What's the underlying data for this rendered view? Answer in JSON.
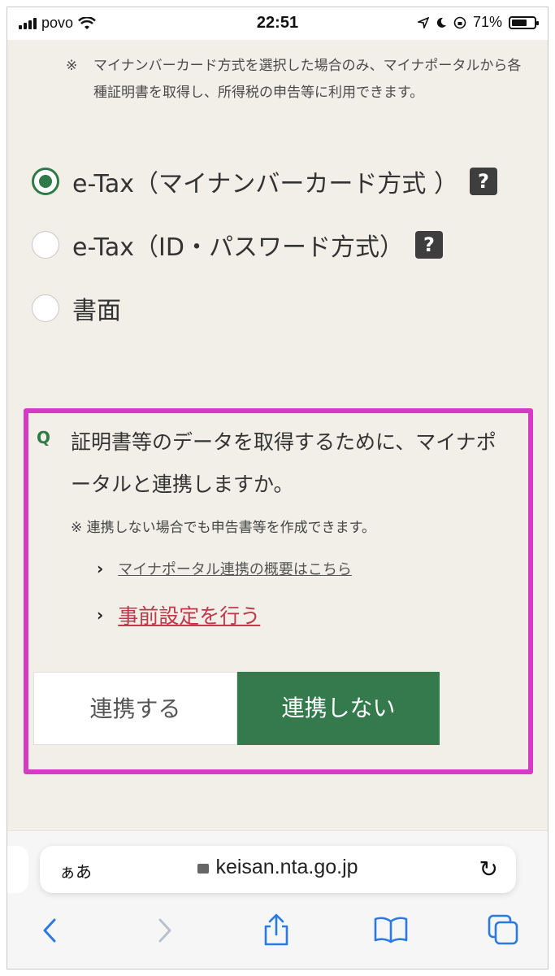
{
  "status_bar": {
    "carrier": "povo",
    "time": "22:51",
    "battery": "71%",
    "battery_level": 0.71
  },
  "note_top": {
    "mark": "※",
    "text": "マイナンバーカード方式を選択した場合のみ、マイナポータルから各種証明書を取得し、所得税の申告等に利用できます。"
  },
  "options": [
    {
      "label": "e-Tax（マイナンバーカード方式 ）",
      "checked": true,
      "help": "?"
    },
    {
      "label": "e-Tax（ID・パスワード方式）",
      "checked": false,
      "help": "?"
    },
    {
      "label": "書面",
      "checked": false
    }
  ],
  "question": {
    "mark": "Q",
    "text": "証明書等のデータを取得するために、マイナポータルと連携しますか。",
    "note": "※ 連携しない場合でも申告書等を作成できます。",
    "links": [
      {
        "label": "マイナポータル連携の概要はこちら"
      },
      {
        "label": "事前設定を行う"
      }
    ],
    "buttons": {
      "yes": "連携する",
      "no": "連携しない"
    }
  },
  "browser": {
    "aa": "ぁあ",
    "url": "keisan.nta.go.jp"
  },
  "colors": {
    "accent_green": "#2f7a46",
    "highlight_box": "#d63cc3",
    "link_red": "#c0384b",
    "ios_blue": "#2a7ae2"
  }
}
